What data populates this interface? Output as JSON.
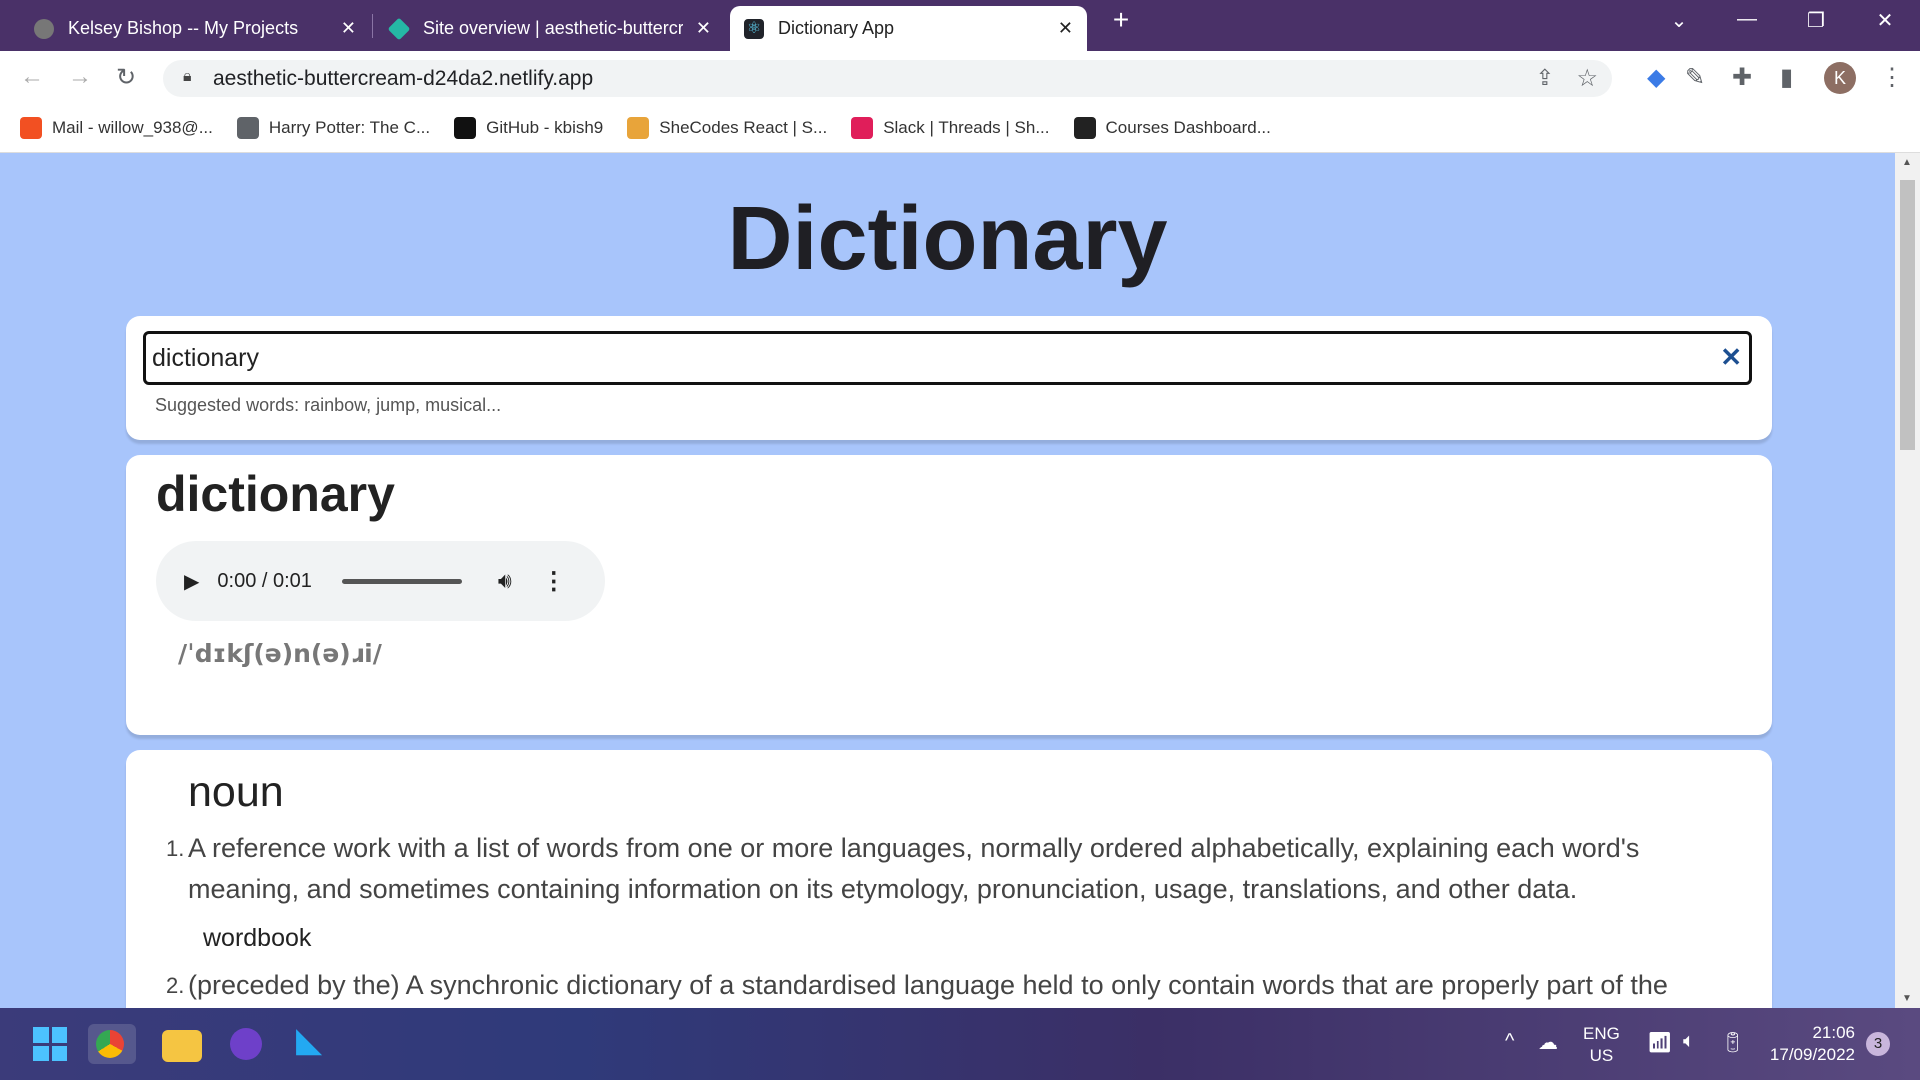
{
  "browser": {
    "tabs": [
      {
        "label": "Kelsey Bishop -- My Projects",
        "icon": "globe-icon"
      },
      {
        "label": "Site overview | aesthetic-buttercream",
        "icon": "netlify-icon"
      },
      {
        "label": "Dictionary App",
        "icon": "react-icon",
        "active": true
      }
    ],
    "url": "aesthetic-buttercream-d24da2.netlify.app",
    "profile_initial": "K",
    "bookmarks": [
      {
        "label": "Mail - willow_938@...",
        "color": "#f25022"
      },
      {
        "label": "Harry Potter: The C...",
        "color": "#5f6368"
      },
      {
        "label": "GitHub - kbish9",
        "color": "#111"
      },
      {
        "label": "SheCodes React | S...",
        "color": "#e8a43a"
      },
      {
        "label": "Slack | Threads | Sh...",
        "color": "#e01e5a"
      },
      {
        "label": "Courses Dashboard...",
        "color": "#222"
      }
    ]
  },
  "app": {
    "title": "Dictionary",
    "search": {
      "value": "dictionary",
      "suggestions": "Suggested words: rainbow, jump, musical..."
    },
    "word": "dictionary",
    "audio": {
      "time": "0:00 / 0:01"
    },
    "phonetic": "/ˈdɪkʃ(ə)n(ə)ɹi/",
    "meaning": {
      "part_of_speech": "noun",
      "definitions": [
        {
          "num": "1.",
          "text": "A reference work with a list of words from one or more languages, normally ordered alphabetically, explaining each word's meaning, and sometimes containing information on its etymology, pronunciation, usage, translations, and other data.",
          "synonym": "wordbook"
        },
        {
          "num": "2.",
          "text": "(preceded by the) A synchronic dictionary of a standardised language held to only contain words that are properly part of the"
        }
      ]
    }
  },
  "taskbar": {
    "lang1": "ENG",
    "lang2": "US",
    "time": "21:06",
    "date": "17/09/2022",
    "notifications": "3"
  },
  "colors": {
    "tabbar": "#4a3168",
    "page_bg": "#a8c5fb",
    "clear_icon": "#1d4f91"
  }
}
